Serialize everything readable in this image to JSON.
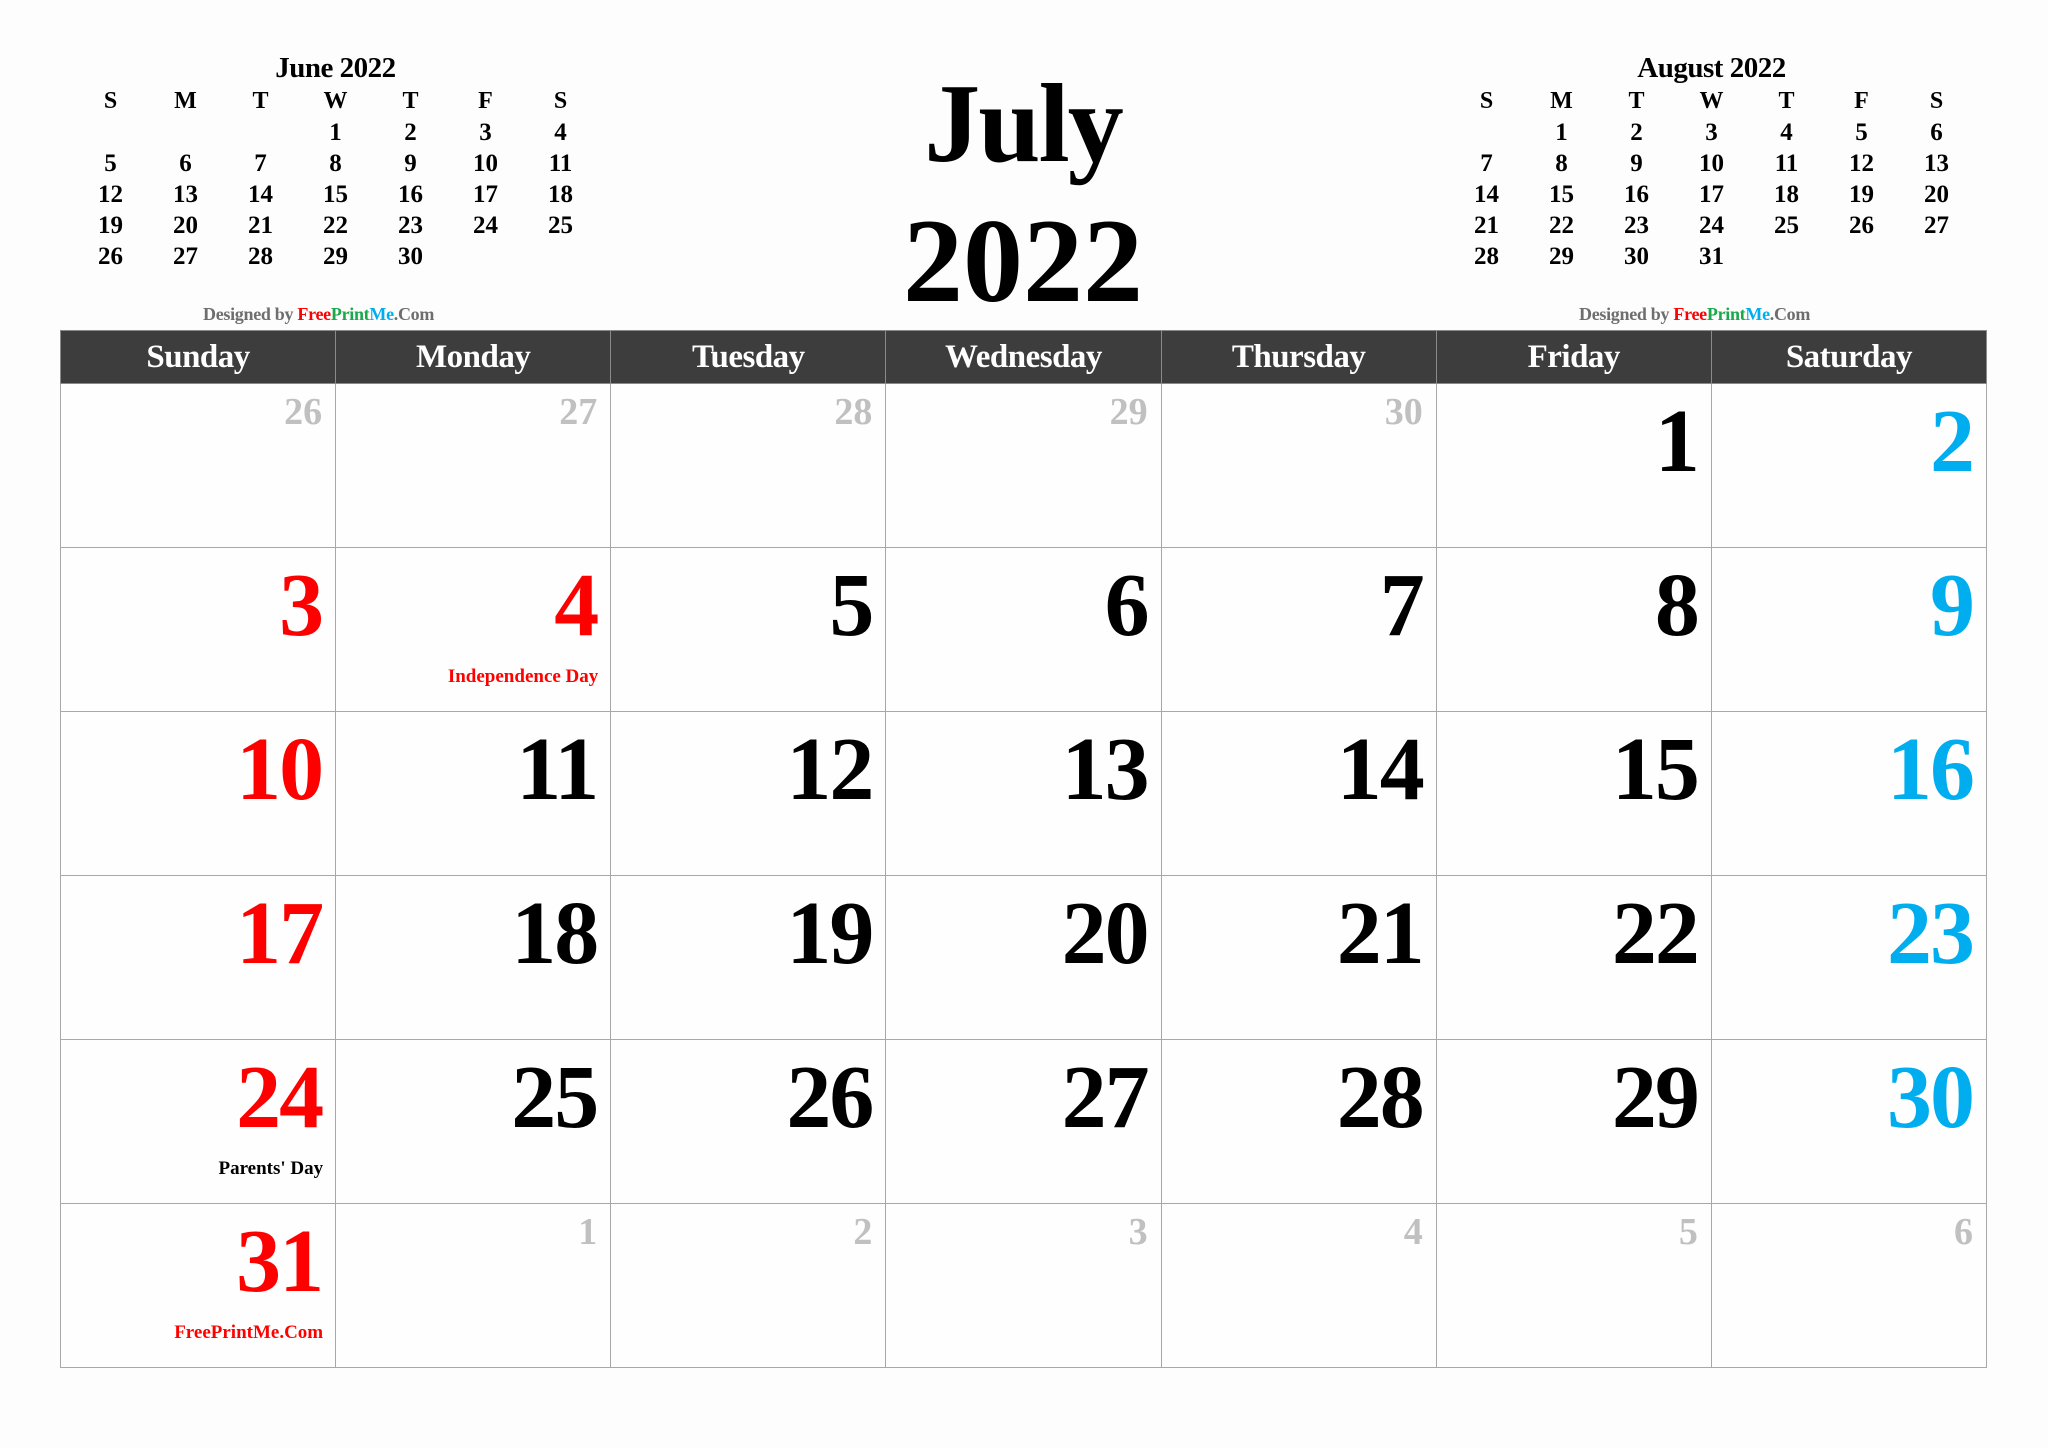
{
  "title": {
    "month": "July",
    "year": "2022"
  },
  "colors": {
    "weekday_header_bg": "#3d3d3d",
    "sunday": "#ff0000",
    "saturday": "#00aeef",
    "weekday": "#000000",
    "muted": "#c0c0c0"
  },
  "credit": {
    "prefix": "Designed by ",
    "free": "Free",
    "print": "Print",
    "me": "Me",
    "suffix": ".Com"
  },
  "mini_prev": {
    "title": "June 2022",
    "weekdays": [
      "S",
      "M",
      "T",
      "W",
      "T",
      "F",
      "S"
    ],
    "cells": [
      "",
      "",
      "",
      "1",
      "2",
      "3",
      "4",
      "5",
      "6",
      "7",
      "8",
      "9",
      "10",
      "11",
      "12",
      "13",
      "14",
      "15",
      "16",
      "17",
      "18",
      "19",
      "20",
      "21",
      "22",
      "23",
      "24",
      "25",
      "26",
      "27",
      "28",
      "29",
      "30",
      "",
      "",
      ""
    ]
  },
  "mini_next": {
    "title": "August 2022",
    "weekdays": [
      "S",
      "M",
      "T",
      "W",
      "T",
      "F",
      "S"
    ],
    "cells": [
      "",
      "1",
      "2",
      "3",
      "4",
      "5",
      "6",
      "7",
      "8",
      "9",
      "10",
      "11",
      "12",
      "13",
      "14",
      "15",
      "16",
      "17",
      "18",
      "19",
      "20",
      "21",
      "22",
      "23",
      "24",
      "25",
      "26",
      "27",
      "28",
      "29",
      "30",
      "31",
      "",
      "",
      ""
    ]
  },
  "weekdays": [
    "Sunday",
    "Monday",
    "Tuesday",
    "Wednesday",
    "Thursday",
    "Friday",
    "Saturday"
  ],
  "weeks": [
    [
      {
        "d": "26",
        "t": "muted"
      },
      {
        "d": "27",
        "t": "muted"
      },
      {
        "d": "28",
        "t": "muted"
      },
      {
        "d": "29",
        "t": "muted"
      },
      {
        "d": "30",
        "t": "muted"
      },
      {
        "d": "1",
        "t": "black"
      },
      {
        "d": "2",
        "t": "blue"
      }
    ],
    [
      {
        "d": "3",
        "t": "red"
      },
      {
        "d": "4",
        "t": "red",
        "note": "Independence Day",
        "note_color": "red"
      },
      {
        "d": "5",
        "t": "black"
      },
      {
        "d": "6",
        "t": "black"
      },
      {
        "d": "7",
        "t": "black"
      },
      {
        "d": "8",
        "t": "black"
      },
      {
        "d": "9",
        "t": "blue"
      }
    ],
    [
      {
        "d": "10",
        "t": "red"
      },
      {
        "d": "11",
        "t": "black"
      },
      {
        "d": "12",
        "t": "black"
      },
      {
        "d": "13",
        "t": "black"
      },
      {
        "d": "14",
        "t": "black"
      },
      {
        "d": "15",
        "t": "black"
      },
      {
        "d": "16",
        "t": "blue"
      }
    ],
    [
      {
        "d": "17",
        "t": "red"
      },
      {
        "d": "18",
        "t": "black"
      },
      {
        "d": "19",
        "t": "black"
      },
      {
        "d": "20",
        "t": "black"
      },
      {
        "d": "21",
        "t": "black"
      },
      {
        "d": "22",
        "t": "black"
      },
      {
        "d": "23",
        "t": "blue"
      }
    ],
    [
      {
        "d": "24",
        "t": "red",
        "note": "Parents' Day",
        "note_color": "black"
      },
      {
        "d": "25",
        "t": "black"
      },
      {
        "d": "26",
        "t": "black"
      },
      {
        "d": "27",
        "t": "black"
      },
      {
        "d": "28",
        "t": "black"
      },
      {
        "d": "29",
        "t": "black"
      },
      {
        "d": "30",
        "t": "blue"
      }
    ],
    [
      {
        "d": "31",
        "t": "red",
        "note": "FreePrintMe.Com",
        "note_color": "red"
      },
      {
        "d": "1",
        "t": "muted"
      },
      {
        "d": "2",
        "t": "muted"
      },
      {
        "d": "3",
        "t": "muted"
      },
      {
        "d": "4",
        "t": "muted"
      },
      {
        "d": "5",
        "t": "muted"
      },
      {
        "d": "6",
        "t": "muted"
      }
    ]
  ]
}
